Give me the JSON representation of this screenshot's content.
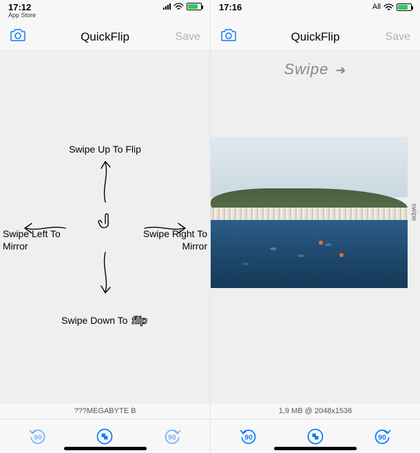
{
  "left": {
    "status": {
      "time": "17:12",
      "sub": "App Store",
      "carrier": ""
    },
    "nav": {
      "title": "QuickFlip",
      "save": "Save"
    },
    "instructions": {
      "up": "Swipe Up To Flip",
      "left": "Swipe Left To Mirror",
      "right": "Swipe Right To Mirror",
      "down_prefix": "Swipe Down To ",
      "down_flip": "flip"
    },
    "info": "???MEGABYTE B",
    "toolbar": {
      "rotate_ccw": "90",
      "rotate_cw": "90"
    }
  },
  "right": {
    "status": {
      "time": "17:16",
      "carrier": "All"
    },
    "nav": {
      "title": "QuickFlip",
      "save": "Save"
    },
    "swipe_hint": "Swipe",
    "side_hint": "swipe",
    "info": "1,9 MB @ 2048x1536",
    "toolbar": {
      "rotate_ccw": "90",
      "rotate_cw": "90"
    }
  },
  "icons": {
    "camera": "camera-icon",
    "share": "share-icon",
    "rotate_ccw": "rotate-ccw-icon",
    "rotate_cw": "rotate-cw-icon"
  }
}
